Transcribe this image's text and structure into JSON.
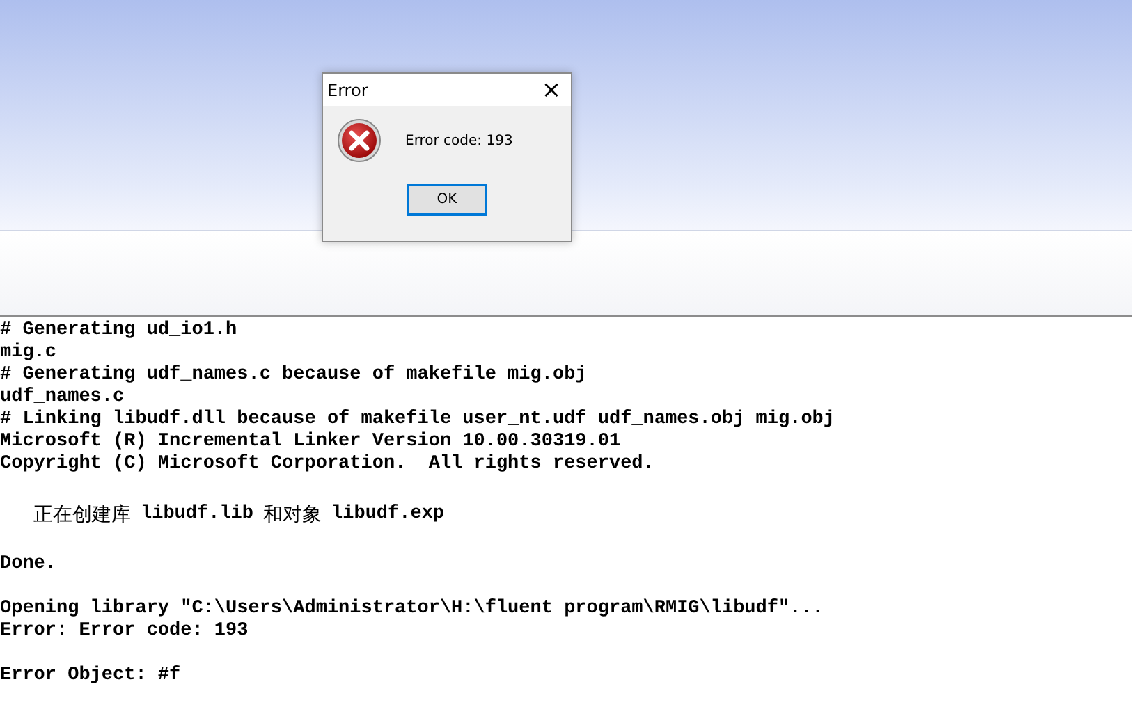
{
  "console": {
    "blocks": [
      {
        "lines": [
          {
            "kind": "plain",
            "parts": [
              {
                "kind": "mono",
                "text": "# Generating ud_io1.h"
              }
            ]
          },
          {
            "kind": "plain",
            "parts": [
              {
                "kind": "mono",
                "text": "mig.c"
              }
            ]
          },
          {
            "kind": "plain",
            "parts": [
              {
                "kind": "mono",
                "text": "# Generating udf_names.c because of makefile mig.obj"
              }
            ]
          },
          {
            "kind": "plain",
            "parts": [
              {
                "kind": "mono",
                "text": "udf_names.c"
              }
            ]
          },
          {
            "kind": "plain",
            "parts": [
              {
                "kind": "mono",
                "text": "# Linking libudf.dll because of makefile user_nt.udf udf_names.obj mig.obj"
              }
            ]
          },
          {
            "kind": "plain",
            "parts": [
              {
                "kind": "mono",
                "text": "Microsoft (R) Incremental Linker Version 10.00.30319.01"
              }
            ]
          },
          {
            "kind": "plain",
            "parts": [
              {
                "kind": "mono",
                "text": "Copyright (C) Microsoft Corporation.  All rights reserved."
              }
            ]
          }
        ]
      },
      {
        "lines": [
          {
            "kind": "indented",
            "parts": [
              {
                "kind": "cjk",
                "text": "正在创建库"
              },
              {
                "kind": "mono",
                "text": "libudf.lib"
              },
              {
                "kind": "cjk",
                "text": "和对象"
              },
              {
                "kind": "mono",
                "text": "libudf.exp"
              }
            ]
          }
        ]
      },
      {
        "lines": [
          {
            "kind": "plain",
            "parts": [
              {
                "kind": "mono",
                "text": "Done."
              }
            ]
          }
        ]
      },
      {
        "lines": [
          {
            "kind": "plain",
            "parts": [
              {
                "kind": "mono",
                "text": "Opening library \"C:\\Users\\Administrator\\H:\\fluent program\\RMIG\\libudf\"..."
              }
            ]
          },
          {
            "kind": "plain",
            "parts": [
              {
                "kind": "mono",
                "text": "Error: Error code: 193"
              }
            ]
          }
        ]
      },
      {
        "lines": [
          {
            "kind": "plain",
            "parts": [
              {
                "kind": "mono",
                "text": "Error Object: #f"
              }
            ]
          }
        ]
      }
    ]
  },
  "dialog": {
    "title": "Error",
    "close": "×",
    "message": "Error code: 193",
    "buttons": [
      {
        "label": "OK",
        "focused": true
      }
    ]
  }
}
